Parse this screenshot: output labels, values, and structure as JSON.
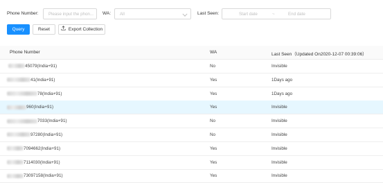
{
  "filters": {
    "phone_label": "Phone Number:",
    "phone_placeholder": "Please input the phon...",
    "wa_label": "WA:",
    "wa_value": "All",
    "last_seen_label": "Last Seen:",
    "start_placeholder": "Start date",
    "date_separator": "~",
    "end_placeholder": "End date"
  },
  "buttons": {
    "query": "Query",
    "reset": "Reset",
    "export": "Export Collection"
  },
  "table": {
    "columns": [
      "Phone Number",
      "WA",
      "Last Seen（Updated On2020-12-07 00:39:06）"
    ],
    "rows": [
      {
        "phone": "45079(India+91)",
        "wa": "No",
        "last_seen": "Invisible"
      },
      {
        "phone": "41(India+91)",
        "wa": "Yes",
        "last_seen": "1Days ago"
      },
      {
        "phone": "78(India+91)",
        "wa": "Yes",
        "last_seen": "1Days ago"
      },
      {
        "phone": "960(India+91)",
        "wa": "Yes",
        "last_seen": "Invisible",
        "highlighted": true
      },
      {
        "phone": "7033(India+91)",
        "wa": "No",
        "last_seen": "Invisible"
      },
      {
        "phone": "97280(India+91)",
        "wa": "No",
        "last_seen": "Invisible"
      },
      {
        "phone": "7094662(India+91)",
        "wa": "Yes",
        "last_seen": "Invisible"
      },
      {
        "phone": "7114030(India+91)",
        "wa": "Yes",
        "last_seen": "Invisible"
      },
      {
        "phone": "73097158(India+91)",
        "wa": "Yes",
        "last_seen": "Invisible"
      }
    ]
  },
  "icons": {
    "export": "export-icon",
    "dropdown": "chevron-down-icon"
  },
  "colors": {
    "primary": "#1890ff",
    "row_highlight": "#e6f7ff",
    "header_bg": "#fafafa"
  }
}
